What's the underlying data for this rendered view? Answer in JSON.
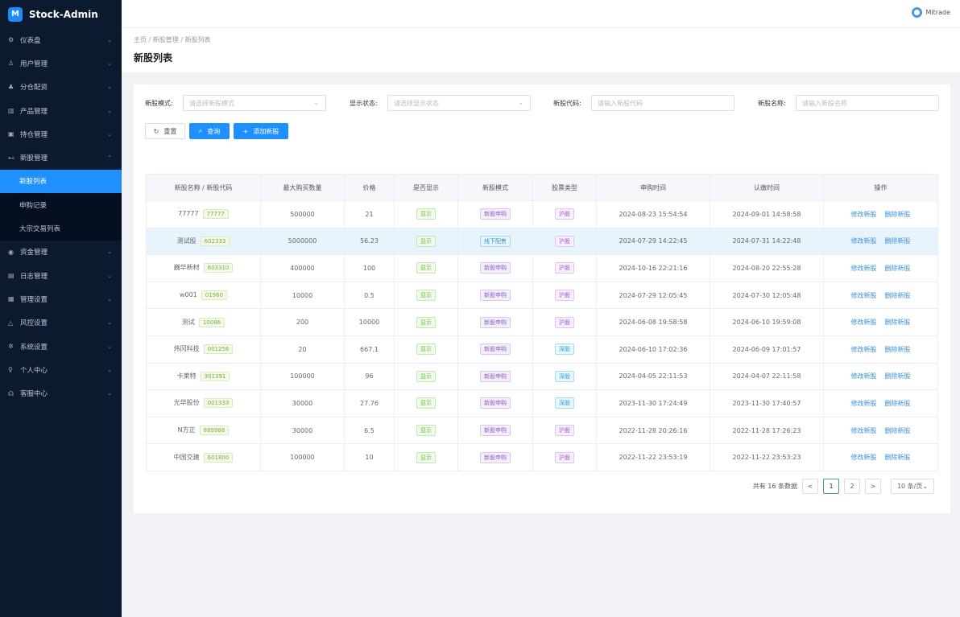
{
  "app": {
    "title": "Stock-Admin",
    "user": "Mitrade"
  },
  "sidebar": {
    "items": [
      {
        "label": "仪表盘",
        "icon": "dashboard-icon",
        "glyph": "⚙"
      },
      {
        "label": "用户管理",
        "icon": "users-icon",
        "glyph": "♙"
      },
      {
        "label": "分仓配资",
        "icon": "split-icon",
        "glyph": "♣"
      },
      {
        "label": "产品管理",
        "icon": "chart-icon",
        "glyph": "▥"
      },
      {
        "label": "持仓管理",
        "icon": "position-icon",
        "glyph": "▣"
      },
      {
        "label": "新股管理",
        "icon": "ipo-icon",
        "glyph": "⊷",
        "expanded": true,
        "children": [
          {
            "label": "新股列表",
            "active": true
          },
          {
            "label": "申购记录"
          },
          {
            "label": "大宗交易列表"
          }
        ]
      },
      {
        "label": "资金管理",
        "icon": "money-icon",
        "glyph": "◉"
      },
      {
        "label": "日志管理",
        "icon": "log-icon",
        "glyph": "▤"
      },
      {
        "label": "管理设置",
        "icon": "settings-box-icon",
        "glyph": "▦"
      },
      {
        "label": "风控设置",
        "icon": "warning-icon",
        "glyph": "△"
      },
      {
        "label": "系统设置",
        "icon": "gear-icon",
        "glyph": "✲"
      },
      {
        "label": "个人中心",
        "icon": "user-icon",
        "glyph": "♀"
      },
      {
        "label": "客服中心",
        "icon": "headset-icon",
        "glyph": "☊"
      }
    ]
  },
  "breadcrumb": [
    "主页",
    "新股管理",
    "新股列表"
  ],
  "page_title": "新股列表",
  "filters": {
    "mode": {
      "label": "新股模式:",
      "placeholder": "请选择新股模式"
    },
    "status": {
      "label": "显示状态:",
      "placeholder": "请选择显示状态"
    },
    "code": {
      "label": "新股代码:",
      "placeholder": "请输入新股代码"
    },
    "name": {
      "label": "新股名称:",
      "placeholder": "请输入新股名称"
    }
  },
  "buttons": {
    "reset": "重置",
    "search": "查询",
    "add": "添加新股"
  },
  "table": {
    "headers": [
      "新股名称 / 新股代码",
      "最大购买数量",
      "价格",
      "是否显示",
      "新股模式",
      "股票类型",
      "申购时间",
      "认缴时间",
      "操作"
    ],
    "rows": [
      [
        "77777",
        "77777",
        "500000",
        "21",
        "显示",
        "新股申购",
        "沪股",
        "2024-08-23 15:54:54",
        "2024-09-01 14:58:58"
      ],
      [
        "测试股",
        "602333",
        "5000000",
        "56.23",
        "显示",
        "线下配售",
        "沪股",
        "2024-07-29 14:22:45",
        "2024-07-31 14:22:48"
      ],
      [
        "巍华新材",
        "603310",
        "400000",
        "100",
        "显示",
        "新股申购",
        "沪股",
        "2024-10-16 22:21:16",
        "2024-08-20 22:55:28"
      ],
      [
        "w001",
        "01960",
        "10000",
        "0.5",
        "显示",
        "新股申购",
        "沪股",
        "2024-07-29 12:05:45",
        "2024-07-30 12:05:48"
      ],
      [
        "测试",
        "10086",
        "200",
        "10000",
        "显示",
        "新股申购",
        "沪股",
        "2024-06-08 19:58:58",
        "2024-06-10 19:59:08"
      ],
      [
        "炜冈科技",
        "001256",
        "20",
        "667.1",
        "显示",
        "新股申购",
        "深股",
        "2024-06-10 17:02:36",
        "2024-06-09 17:01:57"
      ],
      [
        "卡莱特",
        "301391",
        "100000",
        "96",
        "显示",
        "新股申购",
        "深股",
        "2024-04-05 22:11:53",
        "2024-04-07 22:11:58"
      ],
      [
        "光华股份",
        "001333",
        "30000",
        "27.76",
        "显示",
        "新股申购",
        "深股",
        "2023-11-30 17:24:49",
        "2023-11-30 17:40:57"
      ],
      [
        "N方正",
        "889988",
        "30000",
        "6.5",
        "显示",
        "新股申购",
        "沪股",
        "2022-11-28 20:26:16",
        "2022-11-28 17:26:23"
      ],
      [
        "中国交建",
        "601800",
        "100000",
        "10",
        "显示",
        "新股申购",
        "沪股",
        "2022-11-22 23:53:19",
        "2022-11-22 23:53:23"
      ]
    ],
    "edit_label": "修改新股",
    "delete_label": "删除新股"
  },
  "pagination": {
    "total_text": "共有 16 条数据",
    "pages": [
      "1",
      "2"
    ],
    "current": "1",
    "prev": "<",
    "next": ">",
    "page_size": "10 条/页"
  }
}
